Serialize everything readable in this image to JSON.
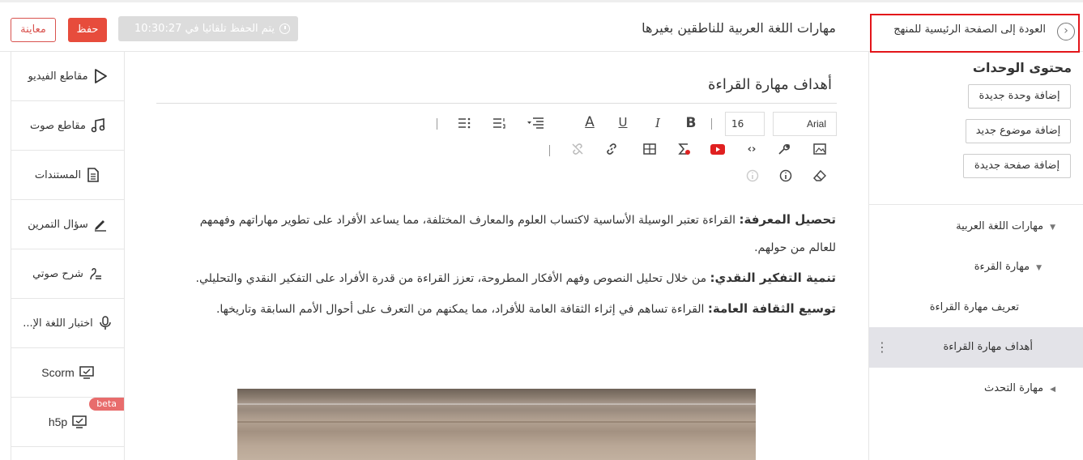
{
  "header": {
    "preview_label": "معاينة",
    "save_label": "حفظ",
    "autosave_text": "يتم الحفظ تلقائيا في 10:30:27",
    "course_title": "مهارات اللغة العربية للناطقين بغيرها",
    "back_label": "العودة إلى الصفحة الرئيسية للمنهج"
  },
  "tools": [
    {
      "label": "مقاطع الفيديو",
      "icon": "play-icon"
    },
    {
      "label": "مقاطع صوت",
      "icon": "music-icon"
    },
    {
      "label": "المستندات",
      "icon": "document-icon"
    },
    {
      "label": "سؤال التمرين",
      "icon": "pencil-icon"
    },
    {
      "label": "شرح صوتي",
      "icon": "voice-explain-icon"
    },
    {
      "label": "اختبار اللغة الإ...",
      "icon": "microphone-icon"
    },
    {
      "label": "Scorm",
      "icon": "monitor-icon"
    },
    {
      "label": "h5p",
      "icon": "monitor-icon",
      "badge": "beta"
    }
  ],
  "editor": {
    "page_heading": "أهداف مهارة القراءة",
    "font_family": "Arial",
    "font_size": "16",
    "paragraphs": [
      {
        "bold": "تحصيل المعرفة:",
        "text": " القراءة تعتبر الوسيلة الأساسية لاكتساب العلوم والمعارف المختلفة، مما يساعد الأفراد على تطوير مهاراتهم وفهمهم للعالم من حولهم."
      },
      {
        "bold": "تنمية التفكير النقدي:",
        "text": " من خلال تحليل النصوص وفهم الأفكار المطروحة، تعزز القراءة من قدرة الأفراد على التفكير النقدي والتحليلي."
      },
      {
        "bold": "توسيع الثقافة العامة:",
        "text": " القراءة تساهم في إثراء الثقافة العامة للأفراد، مما يمكنهم من التعرف على أحوال الأمم السابقة وتاريخها."
      }
    ]
  },
  "panel": {
    "title": "محتوى الوحدات",
    "add_unit": "إضافة وحدة جديدة",
    "add_topic": "إضافة موضوع جديد",
    "add_page": "إضافة صفحة جديدة",
    "tree": [
      {
        "label": "مهارات اللغة العربية"
      },
      {
        "label": "مهارة القرءة"
      },
      {
        "label": "تعريف مهارة القراءة"
      },
      {
        "label": "أهداف مهارة القراءة"
      },
      {
        "label": "مهارة التحدث"
      }
    ]
  }
}
